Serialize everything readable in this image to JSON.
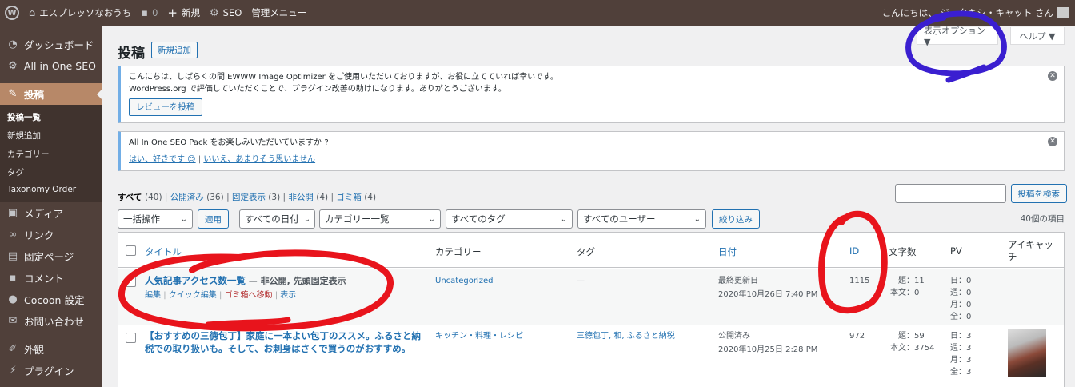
{
  "adminbar": {
    "site_name": "エスプレッソなおうち",
    "comments_count": "0",
    "new_label": "新規",
    "seo_label": "SEO",
    "admin_menu_label": "管理メニュー",
    "greeting": "こんにちは、 ジ・タキシ・キャット さん"
  },
  "sidebar": {
    "items": [
      {
        "label": "ダッシュボード",
        "icon": "dashboard-icon"
      },
      {
        "label": "All in One SEO",
        "icon": "seo-icon"
      },
      {
        "label": "投稿",
        "icon": "pin-icon"
      },
      {
        "label": "メディア",
        "icon": "media-icon"
      },
      {
        "label": "リンク",
        "icon": "link-icon"
      },
      {
        "label": "固定ページ",
        "icon": "page-icon"
      },
      {
        "label": "コメント",
        "icon": "comment-icon"
      },
      {
        "label": "Cocoon 設定",
        "icon": "circle-icon"
      },
      {
        "label": "お問い合わせ",
        "icon": "mail-icon"
      },
      {
        "label": "外観",
        "icon": "brush-icon"
      },
      {
        "label": "プラグイン",
        "icon": "plugin-icon"
      }
    ],
    "submenu": [
      "投稿一覧",
      "新規追加",
      "カテゴリー",
      "タグ",
      "Taxonomy Order"
    ]
  },
  "header": {
    "screen_options": "表示オプション ▼",
    "help": "ヘルプ ▼",
    "title": "投稿",
    "add_new": "新規追加"
  },
  "notices": {
    "ewww_line1": "こんにちは、しばらくの間 EWWW Image Optimizer をご使用いただいておりますが、お役に立てていれば幸いです。",
    "ewww_line2": "WordPress.org で評価していただくことで、プラグイン改善の助けになります。ありがとうございます。",
    "ewww_button": "レビューを投稿",
    "aioseo_line": "All In One SEO Pack をお楽しみいただいていますか ?",
    "aioseo_yes": "はい、好きです 😊",
    "aioseo_sep": "|",
    "aioseo_no": "いいえ、あまりそう思いません"
  },
  "filters": {
    "all": "すべて",
    "all_count": "(40)",
    "published": "公開済み",
    "published_count": "(36)",
    "sticky": "固定表示",
    "sticky_count": "(3)",
    "private": "非公開",
    "private_count": "(4)",
    "trash": "ゴミ箱",
    "trash_count": "(4)",
    "sep": "|"
  },
  "search": {
    "button": "投稿を検索"
  },
  "tablenav": {
    "bulk": "一括操作",
    "apply": "適用",
    "dates": "すべての日付",
    "categories": "カテゴリー一覧",
    "tags": "すべてのタグ",
    "users": "すべてのユーザー",
    "filter": "絞り込み",
    "count": "40個の項目"
  },
  "table": {
    "headers": {
      "title": "タイトル",
      "category": "カテゴリー",
      "tags": "タグ",
      "date": "日付",
      "id": "ID",
      "chars": "文字数",
      "pv": "PV",
      "eyecatch_1": "アイキャッ",
      "eyecatch_2": "チ"
    },
    "rows": [
      {
        "title": "人気記事アクセス数一覧",
        "state": " — 非公開, 先頭固定表示",
        "actions": {
          "edit": "編集",
          "quick": "クイック編集",
          "trash": "ゴミ箱へ移動",
          "view": "表示",
          "sep": "|"
        },
        "category": "Uncategorized",
        "tags": "—",
        "date_status": "最終更新日",
        "date": "2020年10月26日 7:40 PM",
        "id": "1115",
        "chars_title": "題：11",
        "chars_body": "本文：0",
        "pv_day": "日：0",
        "pv_week": "週：0",
        "pv_month": "月：0",
        "pv_all": "全：0"
      },
      {
        "title_line1": "【おすすめの三徳包丁】家庭に一本よい包丁のススメ。ふるさと納",
        "title_line2": "税での取り扱いも。そして、お刺身はさくで買うのがおすすめ。",
        "category": "キッチン・料理・レシピ",
        "tags": "三徳包丁, 和, ふるさと納税",
        "date_status": "公開済み",
        "date": "2020年10月25日 2:28 PM",
        "id": "972",
        "chars_title": "題：59",
        "chars_body": "本文：3754",
        "pv_day": "日：3",
        "pv_week": "週：3",
        "pv_month": "月：3",
        "pv_all": "全：3"
      }
    ]
  },
  "colors": {
    "adminbar": "#50403a",
    "sidebar_current": "#b78868",
    "link": "#2271b1",
    "annotation_red": "#e8141c",
    "annotation_blue": "#3a1fd0"
  }
}
